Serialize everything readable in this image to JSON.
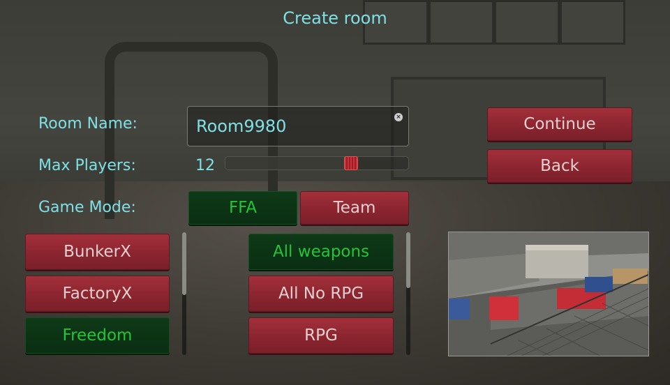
{
  "screen": {
    "title": "Create room"
  },
  "form": {
    "room_name_label": "Room Name:",
    "room_name_value": "Room9980",
    "max_players_label": "Max Players:",
    "max_players_value": "12",
    "max_players_slider_fraction": 0.69,
    "game_mode_label": "Game Mode:"
  },
  "game_modes": [
    {
      "label": "FFA",
      "selected": true
    },
    {
      "label": "Team",
      "selected": false
    }
  ],
  "actions": {
    "continue_label": "Continue",
    "back_label": "Back"
  },
  "maps": [
    {
      "label": "BunkerX",
      "selected": false
    },
    {
      "label": "FactoryX",
      "selected": false
    },
    {
      "label": "Freedom",
      "selected": true
    }
  ],
  "weapons": [
    {
      "label": "All weapons",
      "selected": true
    },
    {
      "label": "All No RPG",
      "selected": false
    },
    {
      "label": "RPG",
      "selected": false
    }
  ],
  "colors": {
    "label_text": "#7fe0e4",
    "button_red": "#8b2530",
    "button_green": "#0a2e12",
    "selected_text": "#24c43a"
  },
  "icons": {
    "clear": "clear-icon"
  }
}
